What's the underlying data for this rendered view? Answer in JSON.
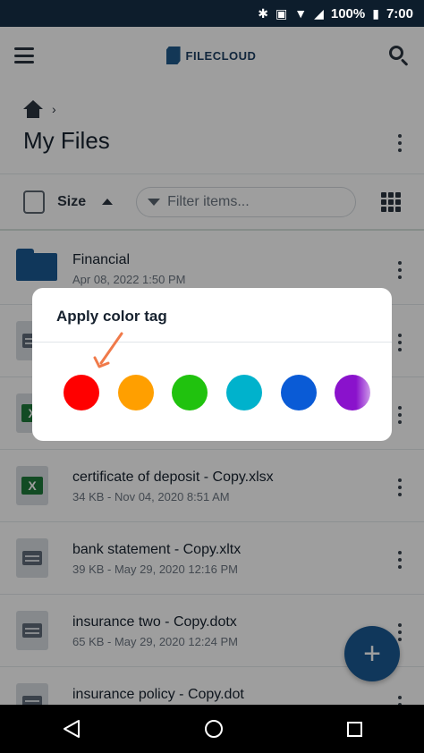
{
  "status_bar": {
    "battery": "100%",
    "time": "7:00"
  },
  "header": {
    "brand": "FILECLOUD"
  },
  "page": {
    "title": "My Files"
  },
  "toolbar": {
    "sort_label": "Size",
    "filter_placeholder": "Filter items..."
  },
  "files": [
    {
      "name": "Financial",
      "meta": "Apr 08, 2022 1:50 PM",
      "icon": "folder-icon"
    },
    {
      "name": "",
      "meta": "",
      "icon": "doc-icon"
    },
    {
      "name": "",
      "meta": "",
      "icon": "excel-icon"
    },
    {
      "name": "certificate of deposit - Copy.xlsx",
      "meta": "34 KB - Nov 04, 2020 8:51 AM",
      "icon": "excel-icon"
    },
    {
      "name": "bank statement - Copy.xltx",
      "meta": "39 KB - May 29, 2020 12:16 PM",
      "icon": "doc-icon"
    },
    {
      "name": "insurance two - Copy.dotx",
      "meta": "65 KB - May 29, 2020 12:24 PM",
      "icon": "doc-icon"
    },
    {
      "name": "insurance policy - Copy.dot",
      "meta": "",
      "icon": "doc-icon"
    }
  ],
  "dialog": {
    "title": "Apply color tag",
    "colors": [
      {
        "name": "red",
        "hex": "#ff0000"
      },
      {
        "name": "orange",
        "hex": "#ff9f00"
      },
      {
        "name": "green",
        "hex": "#20c20e"
      },
      {
        "name": "teal",
        "hex": "#00b2cc"
      },
      {
        "name": "blue",
        "hex": "#0a5bd6"
      },
      {
        "name": "purple",
        "hex": "#8a12cc"
      }
    ]
  },
  "fab": {
    "label": "+"
  },
  "colors": {
    "brand": "#1b5a93",
    "annotation": "#f07a4a"
  }
}
